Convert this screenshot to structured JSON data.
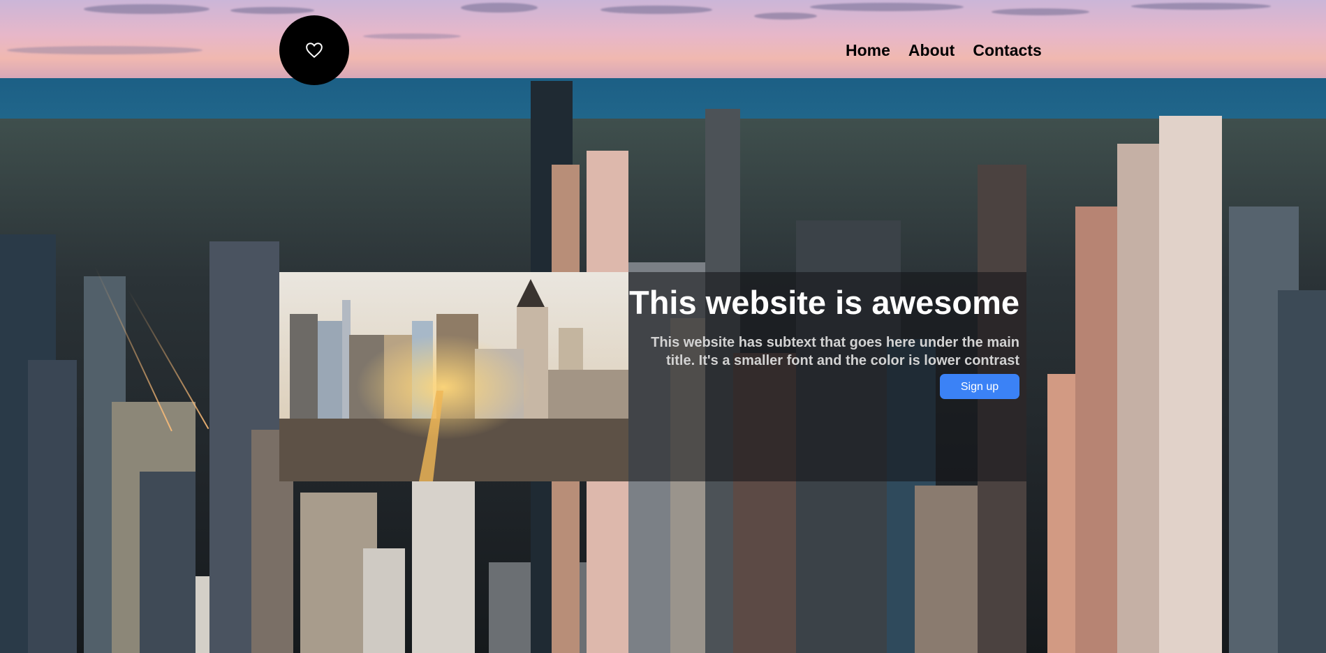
{
  "nav": {
    "items": [
      {
        "label": "Home"
      },
      {
        "label": "About"
      },
      {
        "label": "Contacts"
      }
    ]
  },
  "logo": {
    "icon": "heart-icon"
  },
  "hero": {
    "title": "This website is awesome",
    "subtitle": "This website has subtext that goes here under the main title. It's a smaller font and the color is lower contrast",
    "button_label": "Sign up"
  },
  "colors": {
    "accent": "#3b82f6",
    "logo_bg": "#000000",
    "title": "#ffffff",
    "subtitle": "#d2d2d2"
  }
}
